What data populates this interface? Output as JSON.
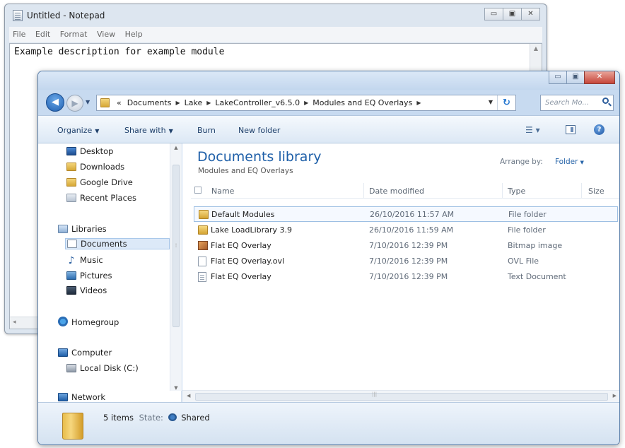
{
  "notepad": {
    "title": "Untitled - Notepad",
    "menu": [
      "File",
      "Edit",
      "Format",
      "View",
      "Help"
    ],
    "content": "Example description for example module",
    "controls": {
      "minimize": "▭",
      "maximize": "▣",
      "close": "✕"
    }
  },
  "explorer": {
    "controls": {
      "minimize": "▭",
      "maximize": "▣",
      "close": "✕"
    },
    "address": {
      "crumbs": [
        "«",
        "Documents",
        "Lake",
        "LakeController_v6.5.0",
        "Modules and EQ Overlays"
      ],
      "separator": "▶"
    },
    "search_placeholder": "Search Mo...",
    "toolbar": {
      "organize": "Organize",
      "share_with": "Share with",
      "burn": "Burn",
      "new_folder": "New folder"
    },
    "nav": {
      "favorites": [
        "Desktop",
        "Downloads",
        "Google Drive",
        "Recent Places"
      ],
      "libraries_label": "Libraries",
      "libraries": [
        "Documents",
        "Music",
        "Pictures",
        "Videos"
      ],
      "homegroup": "Homegroup",
      "computer_label": "Computer",
      "local_disk": "Local Disk (C:)",
      "network": "Network"
    },
    "library": {
      "title": "Documents library",
      "subtitle": "Modules and EQ Overlays",
      "arrange_label": "Arrange by:",
      "arrange_value": "Folder"
    },
    "columns": {
      "name": "Name",
      "date": "Date modified",
      "type": "Type",
      "size": "Size"
    },
    "files": [
      {
        "name": "Default Modules",
        "date": "26/10/2016 11:57 AM",
        "type": "File folder",
        "icon": "folder"
      },
      {
        "name": "Lake LoadLibrary 3.9",
        "date": "26/10/2016 11:59 AM",
        "type": "File folder",
        "icon": "folder"
      },
      {
        "name": "Flat EQ Overlay",
        "date": "7/10/2016 12:39 PM",
        "type": "Bitmap image",
        "icon": "bitmap"
      },
      {
        "name": "Flat EQ Overlay.ovl",
        "date": "7/10/2016 12:39 PM",
        "type": "OVL File",
        "icon": "file"
      },
      {
        "name": "Flat EQ Overlay",
        "date": "7/10/2016 12:39 PM",
        "type": "Text Document",
        "icon": "text"
      }
    ],
    "details": {
      "count": "5 items",
      "state_label": "State:",
      "state_value": "Shared"
    }
  }
}
